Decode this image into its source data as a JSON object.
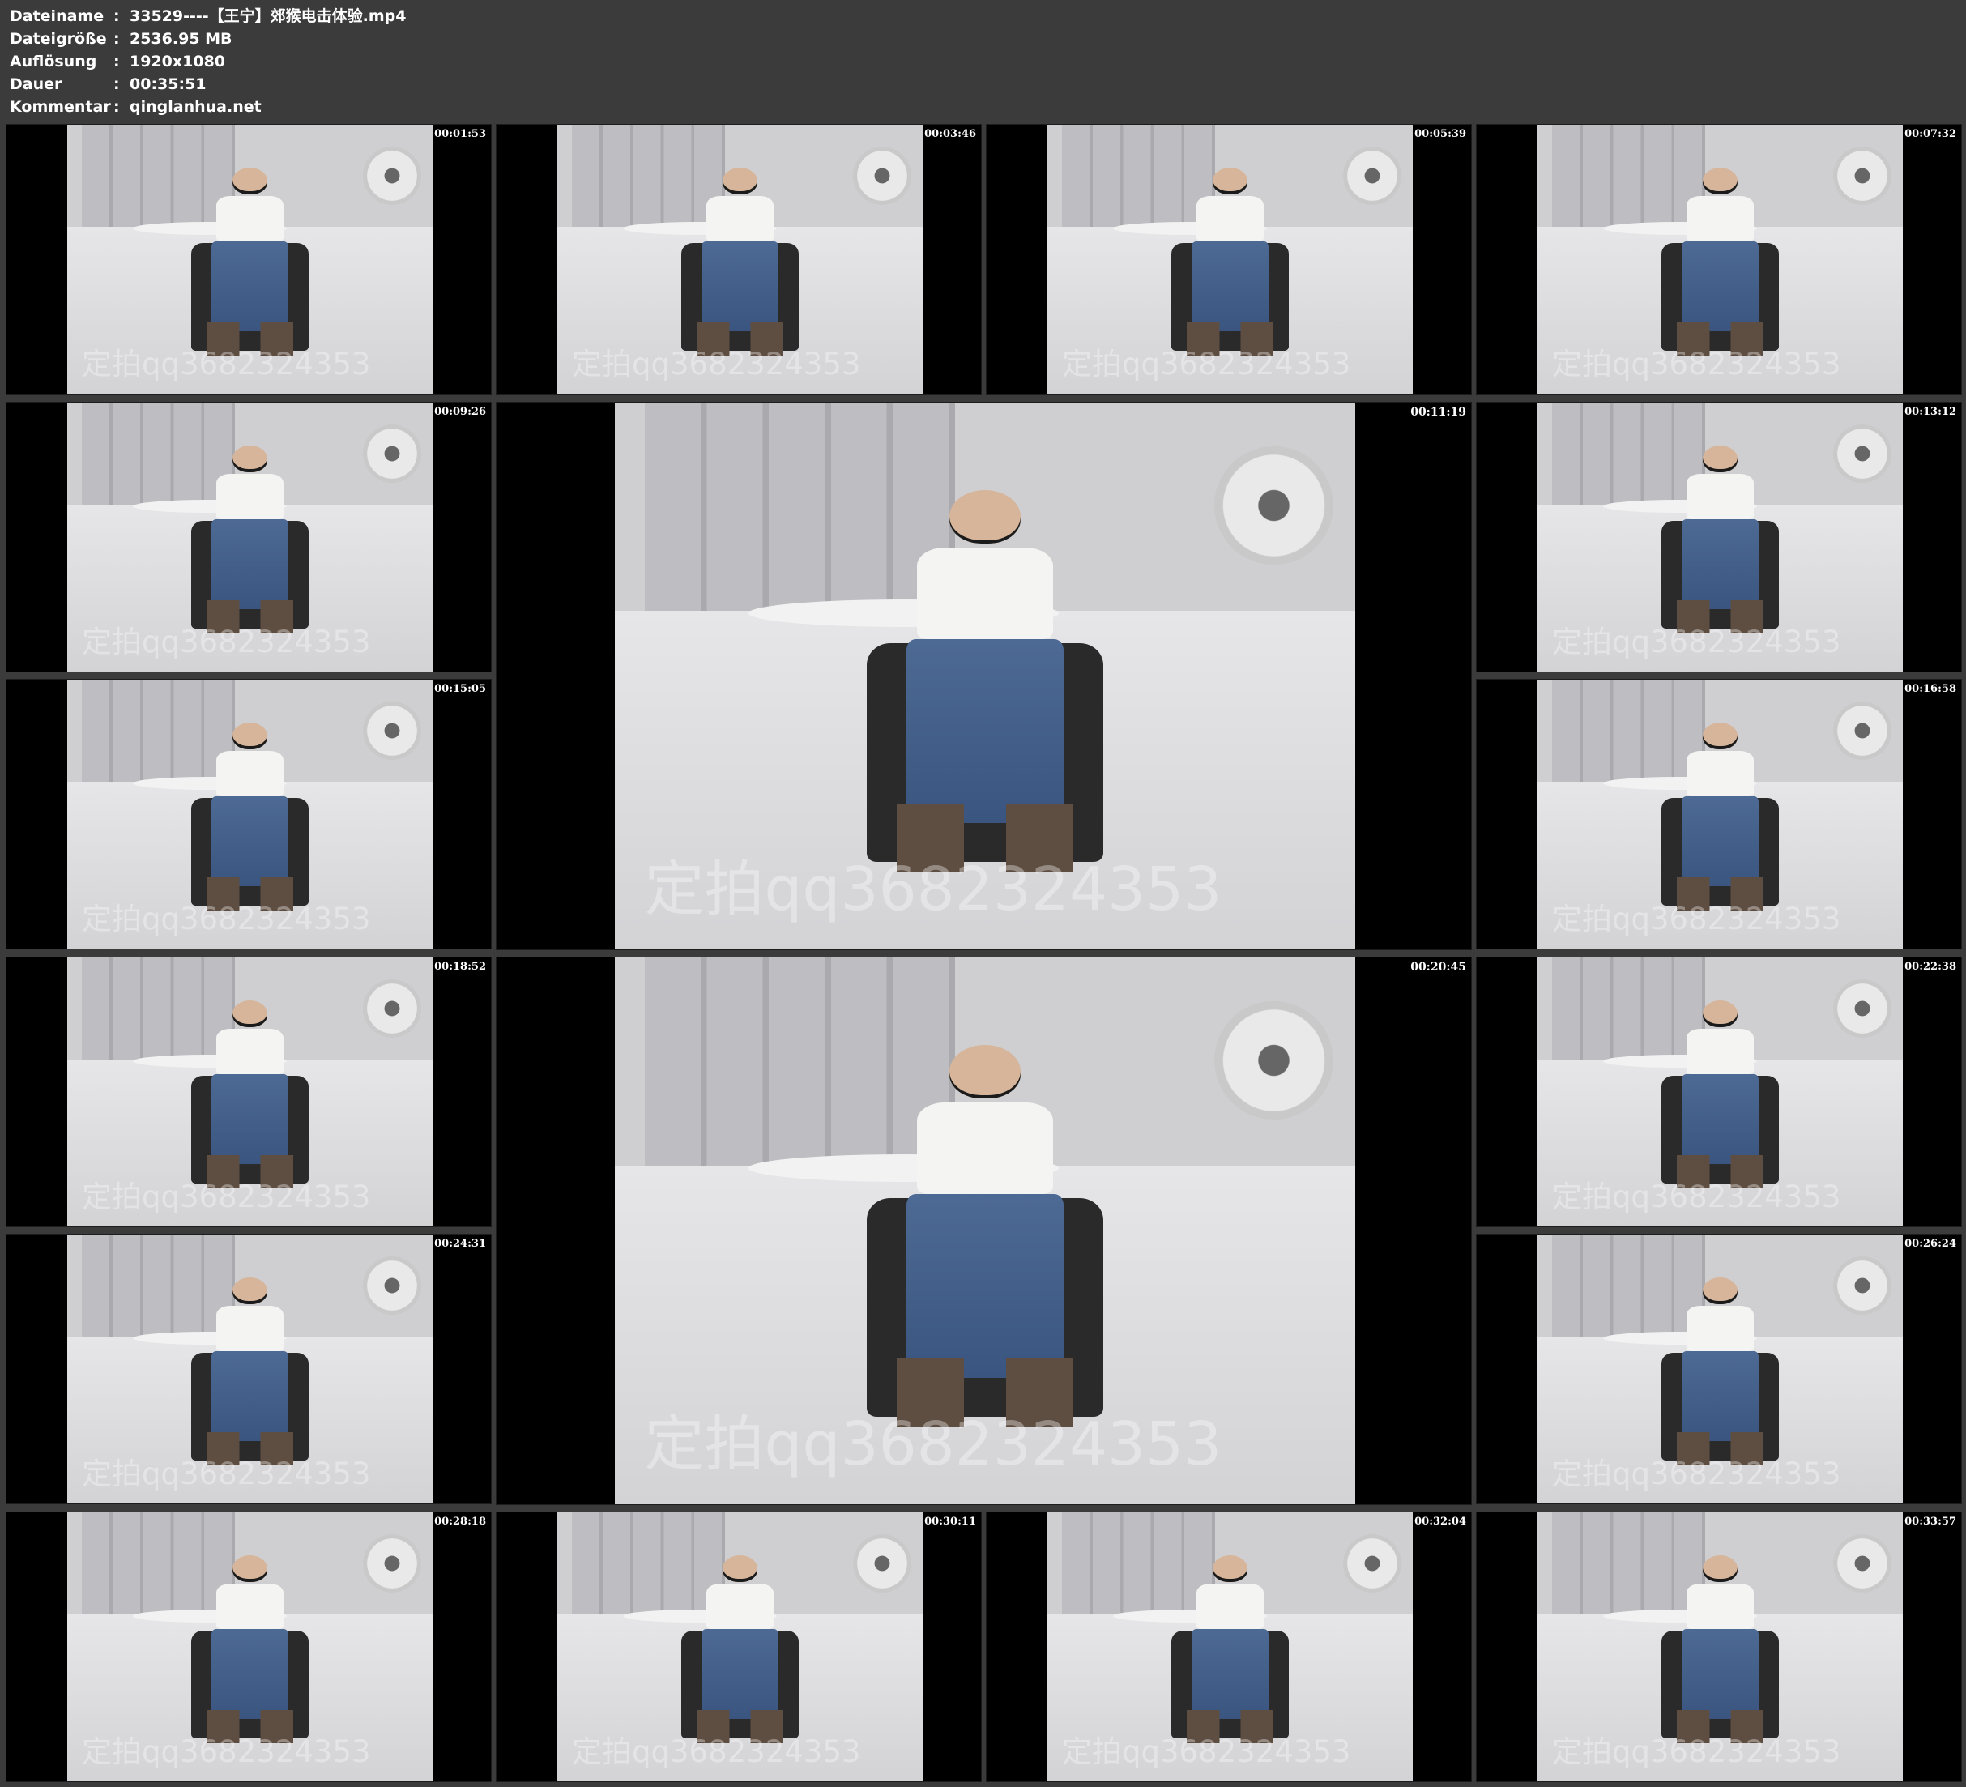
{
  "info": [
    {
      "label": "Dateiname",
      "sep": ":",
      "value": "33529----【王宁】郊猴电击体验.mp4"
    },
    {
      "label": "Dateigröße",
      "sep": ":",
      "value": "2536.95 MB"
    },
    {
      "label": "Auflösung",
      "sep": ":",
      "value": "1920x1080"
    },
    {
      "label": "Dauer",
      "sep": ":",
      "value": "00:35:51"
    },
    {
      "label": "Kommentar",
      "sep": ":",
      "value": "qinglanhua.net"
    }
  ],
  "thumbnails": [
    {
      "time": "00:01:53",
      "watermark": "定拍qq3682324353"
    },
    {
      "time": "00:03:46",
      "watermark": "定拍qq3682324353"
    },
    {
      "time": "00:05:39",
      "watermark": "定拍qq3682324353"
    },
    {
      "time": "00:07:32",
      "watermark": "定拍qq3682324353"
    },
    {
      "time": "00:09:26",
      "watermark": "定拍qq3682324353"
    },
    {
      "time": "00:11:19",
      "watermark": "定拍qq3682324353"
    },
    {
      "time": "00:13:12",
      "watermark": "定拍qq3682324353"
    },
    {
      "time": "00:15:05",
      "watermark": "定拍qq3682324353"
    },
    {
      "time": "00:16:58",
      "watermark": "定拍qq3682324353"
    },
    {
      "time": "00:18:52",
      "watermark": "定拍qq3682324353"
    },
    {
      "time": "00:20:45",
      "watermark": "定拍qq3682324353"
    },
    {
      "time": "00:22:38",
      "watermark": "定拍qq3682324353"
    },
    {
      "time": "00:24:31",
      "watermark": "定拍qq3682324353"
    },
    {
      "time": "00:26:24",
      "watermark": "定拍qq3682324353"
    },
    {
      "time": "00:28:18",
      "watermark": "定拍qq3682324353"
    },
    {
      "time": "00:30:11",
      "watermark": "定拍qq3682324353"
    },
    {
      "time": "00:32:04",
      "watermark": "定拍qq3682324353"
    },
    {
      "time": "00:33:57",
      "watermark": "定拍qq3682324353"
    }
  ]
}
